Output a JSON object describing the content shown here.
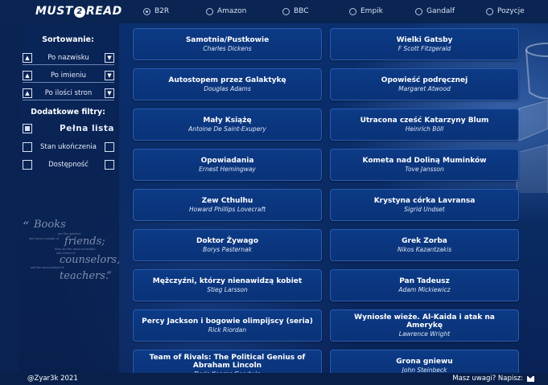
{
  "header": {
    "logo_left": "MUST",
    "logo_mid": "2",
    "logo_right": "READ",
    "lists": [
      {
        "label": "B2R",
        "selected": true
      },
      {
        "label": "Amazon",
        "selected": false
      },
      {
        "label": "BBC",
        "selected": false
      },
      {
        "label": "Empik",
        "selected": false
      },
      {
        "label": "Gandalf",
        "selected": false
      },
      {
        "label": "Pozycje",
        "selected": false
      }
    ]
  },
  "sidebar": {
    "sort_title": "Sortowanie:",
    "sort_options": [
      {
        "label": "Po nazwisku"
      },
      {
        "label": "Po imieniu"
      },
      {
        "label": "Po ilości stron"
      }
    ],
    "filters_title": "Dodatkowe filtry:",
    "filters": [
      {
        "label": "Pełna lista",
        "checked": true
      },
      {
        "label": "Stan ukończenia",
        "checked": false
      },
      {
        "label": "Dostępność",
        "checked": false
      }
    ],
    "quote": {
      "open": "“",
      "w1": "Books",
      "s1": "are the quietest",
      "s2": "and most constant of",
      "w2": "friends;",
      "s3": "they are the most accessible",
      "s4": "and wisest of",
      "w3": "counselors,",
      "s5": "and the most patient of",
      "w4": "teachers.",
      "close": "”"
    }
  },
  "books": [
    {
      "title": "Samotnia/Pustkowie",
      "author": "Charles Dickens"
    },
    {
      "title": "Wielki Gatsby",
      "author": "F Scott Fitzgerald"
    },
    {
      "title": "Autostopem przez Galaktykę",
      "author": "Douglas Adams"
    },
    {
      "title": "Opowieść podręcznej",
      "author": "Margaret Atwood"
    },
    {
      "title": "Mały Książę",
      "author": "Antoine De Saint-Exupery"
    },
    {
      "title": "Utracona cześć Katarzyny Blum",
      "author": "Heinrich Böll"
    },
    {
      "title": "Opowiadania",
      "author": "Ernest Hemingway"
    },
    {
      "title": "Kometa nad Doliną Muminków",
      "author": "Tove Jansson"
    },
    {
      "title": "Zew Cthulhu",
      "author": "Howard Phillips Lovecraft"
    },
    {
      "title": "Krystyna córka Lavransa",
      "author": "Sigrid Undset"
    },
    {
      "title": "Doktor Żywago",
      "author": "Borys Pasternak"
    },
    {
      "title": "Grek Zorba",
      "author": "Nikos Kazantzakis"
    },
    {
      "title": "Mężczyźni, którzy nienawidzą kobiet",
      "author": "Stieg Larsson"
    },
    {
      "title": "Pan Tadeusz",
      "author": "Adam Mickiewicz"
    },
    {
      "title": "Percy Jackson i bogowie olimpijscy (seria)",
      "author": "Rick Riordan"
    },
    {
      "title": "Wyniosłe wieże. Al-Kaida i atak na Amerykę",
      "author": "Lawrence Wright"
    },
    {
      "title": "Team of Rivals: The Political Genius of Abraham Lincoln",
      "author": "Doris Kearns Goodwin"
    },
    {
      "title": "Grona gniewu",
      "author": "John Steinbeck"
    }
  ],
  "footer": {
    "copyright": "@Zyar3k 2021",
    "contact": "Masz uwagi? Napisz:"
  }
}
